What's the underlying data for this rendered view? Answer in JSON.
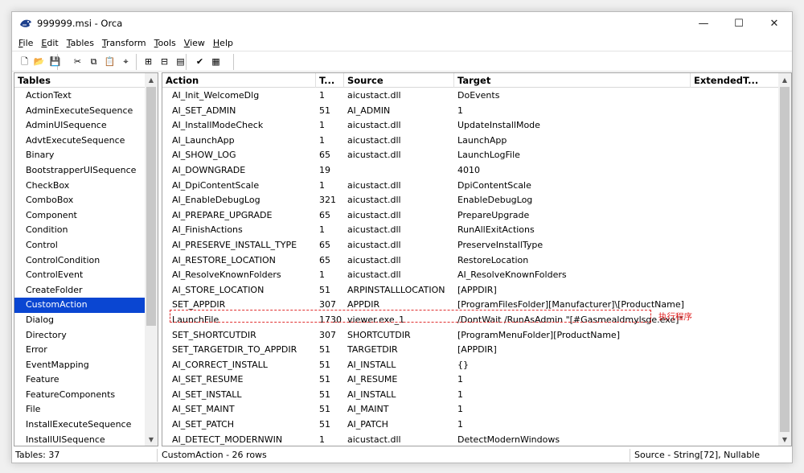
{
  "window": {
    "title": "999999.msi - Orca",
    "minimize_glyph": "—",
    "maximize_glyph": "☐",
    "close_glyph": "✕"
  },
  "menu": [
    {
      "hot": "F",
      "rest": "ile"
    },
    {
      "hot": "E",
      "rest": "dit"
    },
    {
      "hot": "T",
      "rest": "ables"
    },
    {
      "hot": "T",
      "rest": "ransform"
    },
    {
      "hot": "T",
      "rest": "ools"
    },
    {
      "hot": "V",
      "rest": "iew"
    },
    {
      "hot": "H",
      "rest": "elp"
    }
  ],
  "toolbar": [
    {
      "icon": "new-file-icon",
      "glyph": "🗋"
    },
    {
      "icon": "open-folder-icon",
      "glyph": "📂"
    },
    {
      "icon": "save-icon",
      "glyph": "💾"
    },
    {
      "icon": "cut-icon",
      "glyph": "✂"
    },
    {
      "icon": "copy-icon",
      "glyph": "⧉"
    },
    {
      "icon": "paste-icon",
      "glyph": "📋"
    },
    {
      "icon": "find-icon",
      "glyph": "⌖"
    },
    {
      "icon": "add-table-icon",
      "glyph": "⊞"
    },
    {
      "icon": "drop-table-icon",
      "glyph": "⊟"
    },
    {
      "icon": "add-row-icon",
      "glyph": "▤"
    },
    {
      "icon": "validate-icon",
      "glyph": "✔"
    },
    {
      "icon": "merge-module-icon",
      "glyph": "▦"
    }
  ],
  "colors": {
    "selection": "#0a46d2",
    "annotation": "#e02020"
  },
  "tables_pane": {
    "header": "Tables",
    "items": [
      "ActionText",
      "AdminExecuteSequence",
      "AdminUISequence",
      "AdvtExecuteSequence",
      "Binary",
      "BootstrapperUISequence",
      "CheckBox",
      "ComboBox",
      "Component",
      "Condition",
      "Control",
      "ControlCondition",
      "ControlEvent",
      "CreateFolder",
      "CustomAction",
      "Dialog",
      "Directory",
      "Error",
      "EventMapping",
      "Feature",
      "FeatureComponents",
      "File",
      "InstallExecuteSequence",
      "InstallUISequence"
    ],
    "selected_index": 14
  },
  "grid": {
    "columns": [
      "Action",
      "T...",
      "Source",
      "Target",
      "ExtendedT..."
    ],
    "rows": [
      [
        "AI_Init_WelcomeDlg",
        "1",
        "aicustact.dll",
        "DoEvents",
        ""
      ],
      [
        "AI_SET_ADMIN",
        "51",
        "AI_ADMIN",
        "1",
        ""
      ],
      [
        "AI_InstallModeCheck",
        "1",
        "aicustact.dll",
        "UpdateInstallMode",
        ""
      ],
      [
        "AI_LaunchApp",
        "1",
        "aicustact.dll",
        "LaunchApp",
        ""
      ],
      [
        "AI_SHOW_LOG",
        "65",
        "aicustact.dll",
        "LaunchLogFile",
        ""
      ],
      [
        "AI_DOWNGRADE",
        "19",
        "",
        "4010",
        ""
      ],
      [
        "AI_DpiContentScale",
        "1",
        "aicustact.dll",
        "DpiContentScale",
        ""
      ],
      [
        "AI_EnableDebugLog",
        "321",
        "aicustact.dll",
        "EnableDebugLog",
        ""
      ],
      [
        "AI_PREPARE_UPGRADE",
        "65",
        "aicustact.dll",
        "PrepareUpgrade",
        ""
      ],
      [
        "AI_FinishActions",
        "1",
        "aicustact.dll",
        "RunAllExitActions",
        ""
      ],
      [
        "AI_PRESERVE_INSTALL_TYPE",
        "65",
        "aicustact.dll",
        "PreserveInstallType",
        ""
      ],
      [
        "AI_RESTORE_LOCATION",
        "65",
        "aicustact.dll",
        "RestoreLocation",
        ""
      ],
      [
        "AI_ResolveKnownFolders",
        "1",
        "aicustact.dll",
        "AI_ResolveKnownFolders",
        ""
      ],
      [
        "AI_STORE_LOCATION",
        "51",
        "ARPINSTALLLOCATION",
        "[APPDIR]",
        ""
      ],
      [
        "SET_APPDIR",
        "307",
        "APPDIR",
        "[ProgramFilesFolder][Manufacturer]\\[ProductName]",
        ""
      ],
      [
        "LaunchFile",
        "1730",
        "viewer.exe_1",
        "/DontWait /RunAsAdmin \"[#Gasmealdmylsge.exe]\"",
        ""
      ],
      [
        "SET_SHORTCUTDIR",
        "307",
        "SHORTCUTDIR",
        "[ProgramMenuFolder][ProductName]",
        ""
      ],
      [
        "SET_TARGETDIR_TO_APPDIR",
        "51",
        "TARGETDIR",
        "[APPDIR]",
        ""
      ],
      [
        "AI_CORRECT_INSTALL",
        "51",
        "AI_INSTALL",
        "{}",
        ""
      ],
      [
        "AI_SET_RESUME",
        "51",
        "AI_RESUME",
        "1",
        ""
      ],
      [
        "AI_SET_INSTALL",
        "51",
        "AI_INSTALL",
        "1",
        ""
      ],
      [
        "AI_SET_MAINT",
        "51",
        "AI_MAINT",
        "1",
        ""
      ],
      [
        "AI_SET_PATCH",
        "51",
        "AI_PATCH",
        "1",
        ""
      ],
      [
        "AI_DETECT_MODERNWIN",
        "1",
        "aicustact.dll",
        "DetectModernWindows",
        ""
      ]
    ]
  },
  "annotation": {
    "label": "执行程序"
  },
  "status": {
    "tables": "Tables: 37",
    "rows": "CustomAction - 26 rows",
    "column": "Source - String[72], Nullable"
  }
}
